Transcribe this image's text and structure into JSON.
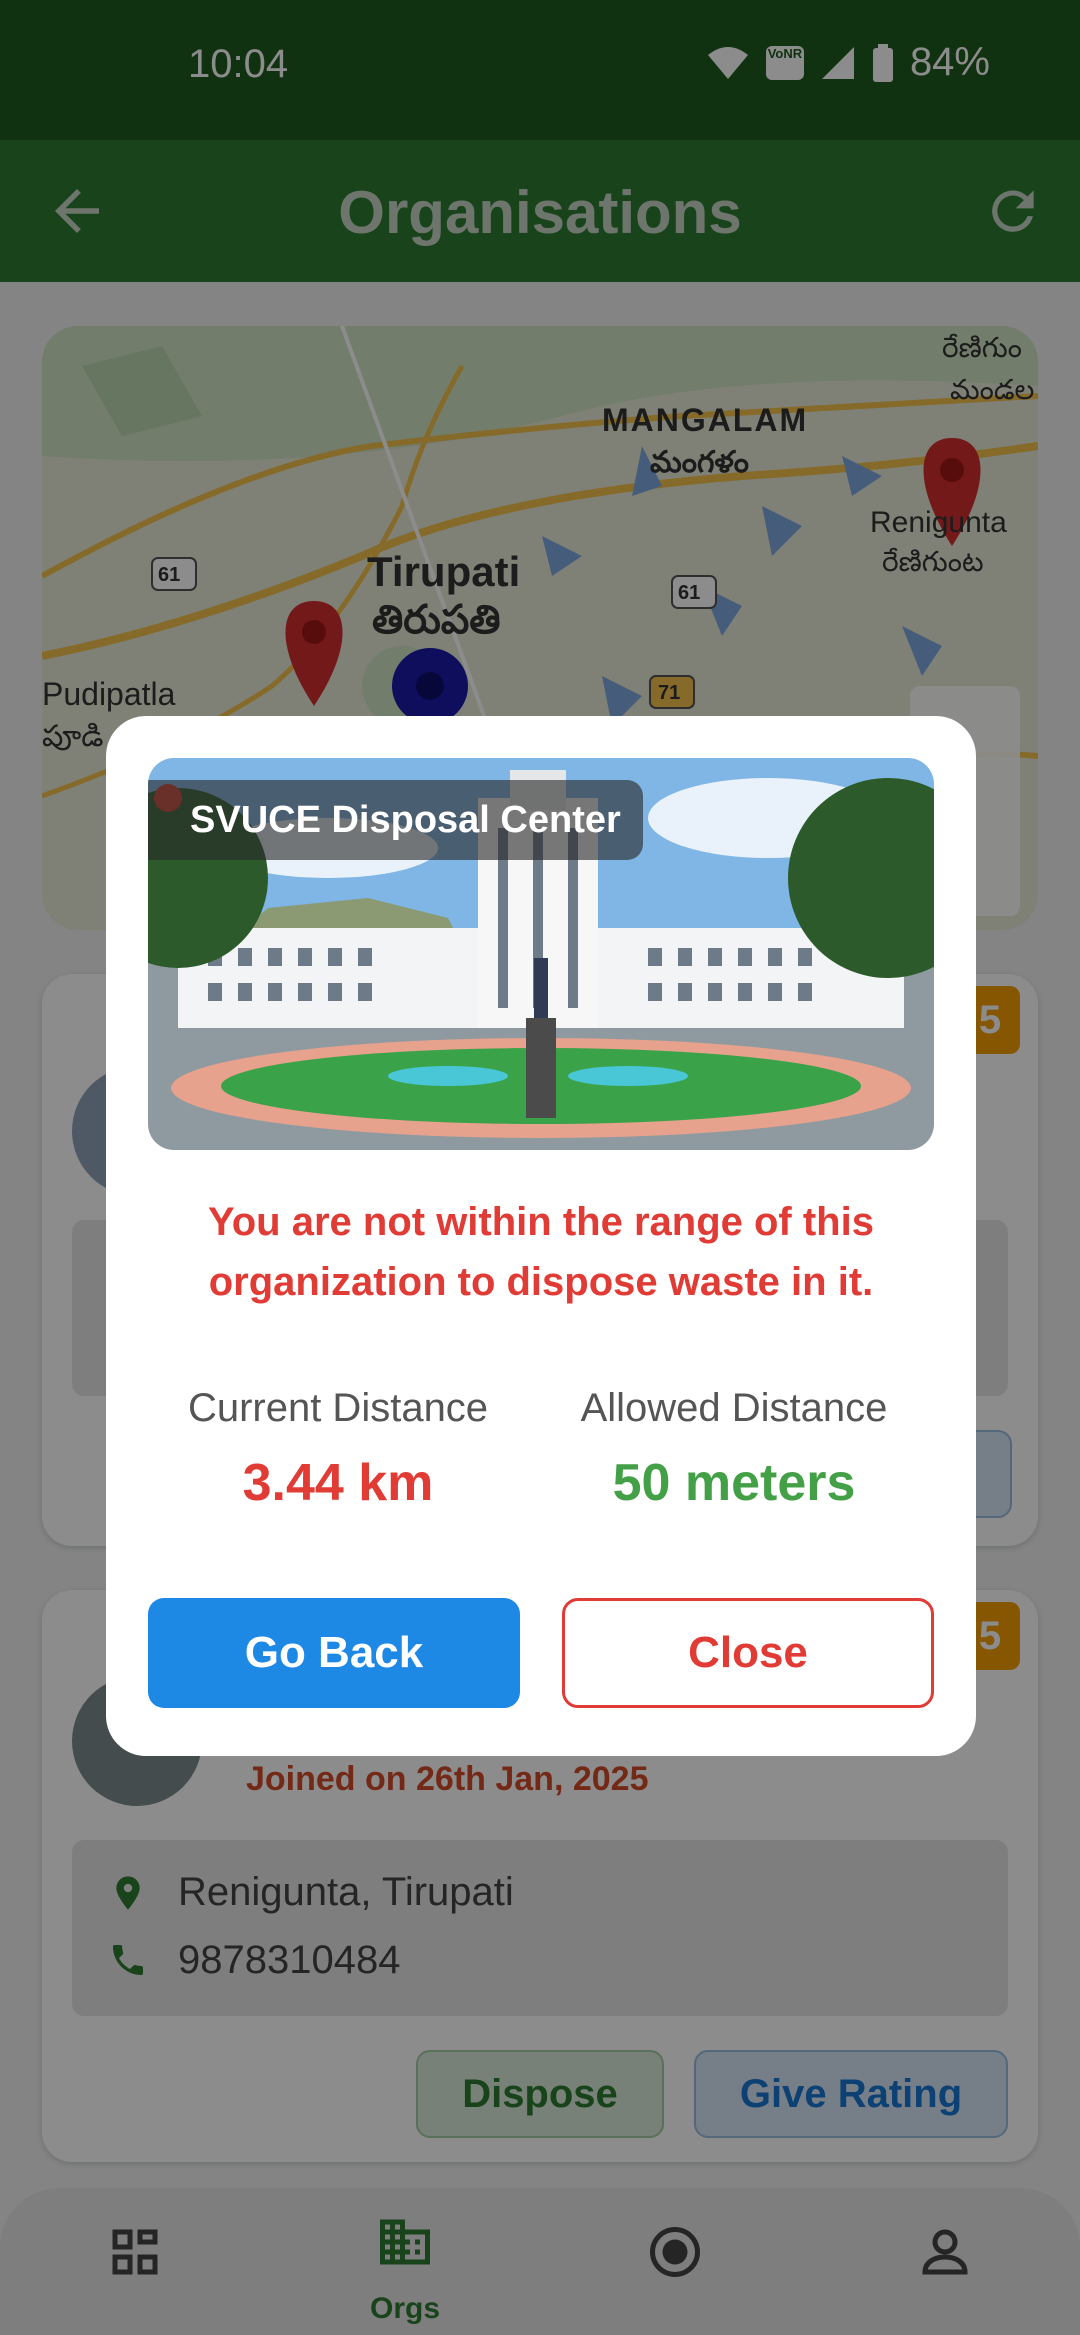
{
  "status": {
    "time": "10:04",
    "battery": "84%",
    "network_badge": "VoNR"
  },
  "appbar": {
    "title": "Organisations"
  },
  "map": {
    "labels": [
      "MANGALAM",
      "మంగళం",
      "Tirupati",
      "తిరుపతి",
      "Renigunta",
      "రేణిగుంట",
      "Pudipatla",
      "పూడి",
      "రేణిగుం",
      "మండల"
    ],
    "road_shields": [
      "61",
      "61",
      "71"
    ]
  },
  "cards": [
    {
      "badge": "5"
    },
    {
      "badge": "5",
      "joined": "Joined on 26th Jan, 2025",
      "location": "Renigunta, Tirupati",
      "phone": "9878310484",
      "dispose_label": "Dispose",
      "rating_label": "Give Rating"
    }
  ],
  "bottom_nav": [
    {
      "label": "",
      "icon": "dashboard-icon"
    },
    {
      "label": "Orgs",
      "icon": "buildings-icon"
    },
    {
      "label": "",
      "icon": "record-icon"
    },
    {
      "label": "",
      "icon": "person-icon"
    }
  ],
  "dialog": {
    "title": "SVUCE Disposal Center",
    "warning": "You are not within the range of this organization to dispose waste in it.",
    "current_label": "Current Distance",
    "current_value": "3.44 km",
    "allowed_label": "Allowed Distance",
    "allowed_value": "50 meters",
    "back_label": "Go Back",
    "close_label": "Close"
  },
  "colors": {
    "primary_green": "#2e7d32",
    "status_green": "#1f5b1e",
    "danger": "#e03b35",
    "success": "#43a047",
    "blue": "#1e88e5",
    "badge": "#f59f00"
  }
}
